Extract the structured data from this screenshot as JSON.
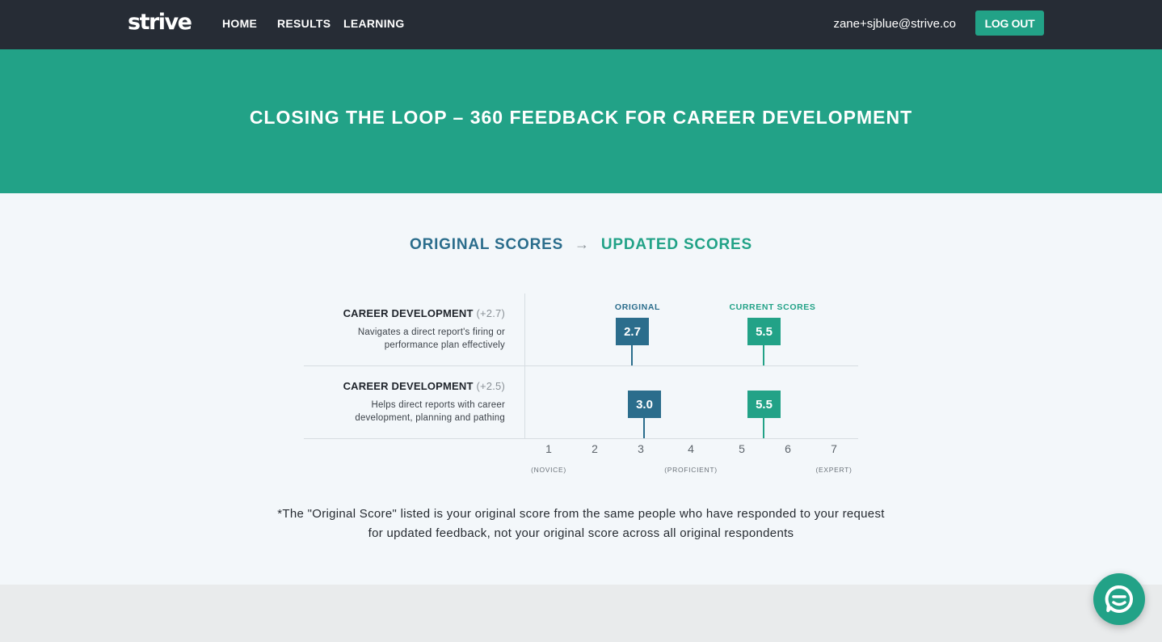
{
  "nav": {
    "logo": "strive",
    "links": [
      "HOME",
      "RESULTS",
      "LEARNING"
    ],
    "user_email": "zane+sjblue@strive.co",
    "logout_label": "LOG OUT"
  },
  "hero": {
    "title": "CLOSING THE LOOP – 360 FEEDBACK FOR CAREER DEVELOPMENT"
  },
  "scores_header": {
    "original": "ORIGINAL SCORES",
    "arrow": "→",
    "updated": "UPDATED SCORES"
  },
  "column_labels": {
    "original": "ORIGINAL",
    "current": "CURRENT SCORES"
  },
  "rows": [
    {
      "title": "CAREER DEVELOPMENT",
      "delta": "(+2.7)",
      "description": "Navigates a direct report's firing or performance plan effectively",
      "original_score": "2.7",
      "current_score": "5.5"
    },
    {
      "title": "CAREER DEVELOPMENT",
      "delta": "(+2.5)",
      "description": "Helps direct reports with career development, planning and pathing",
      "original_score": "3.0",
      "current_score": "5.5"
    }
  ],
  "scale": {
    "ticks": [
      "1",
      "2",
      "3",
      "4",
      "5",
      "6",
      "7"
    ],
    "captions": {
      "novice": "(NOVICE)",
      "proficient": "(PROFICIENT)",
      "expert": "(EXPERT)"
    }
  },
  "footnote": "*The \"Original Score\" listed is your original score from the same people who have responded to your request for updated feedback, not your original score across all original respondents",
  "colors": {
    "nav_bg": "#262c35",
    "accent": "#22a287",
    "original_blue": "#2b6d8c"
  },
  "icons": {
    "chat": "chat-bubble-icon"
  }
}
